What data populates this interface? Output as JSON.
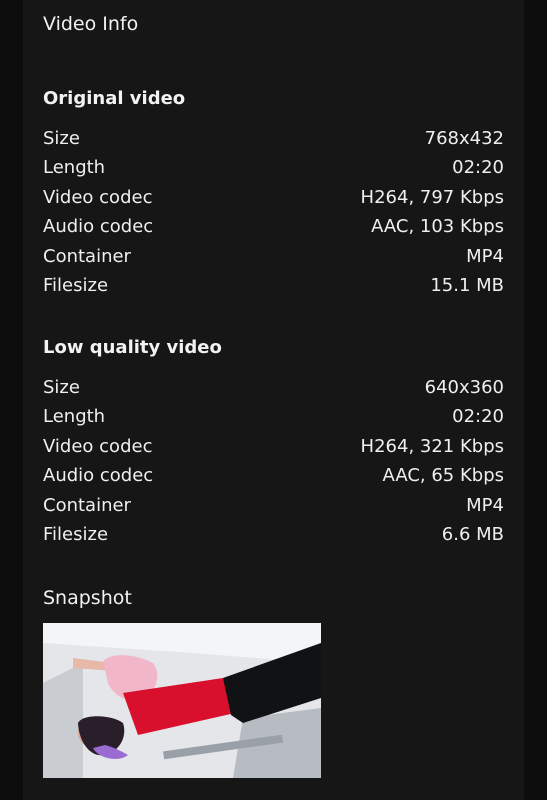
{
  "header": {
    "title": "Video Info"
  },
  "original": {
    "title": "Original video",
    "rows": [
      {
        "label": "Size",
        "value": "768x432"
      },
      {
        "label": "Length",
        "value": "02:20"
      },
      {
        "label": "Video codec",
        "value": "H264, 797 Kbps"
      },
      {
        "label": "Audio codec",
        "value": "AAC, 103 Kbps"
      },
      {
        "label": "Container",
        "value": "MP4"
      },
      {
        "label": "Filesize",
        "value": "15.1 MB"
      }
    ]
  },
  "low_quality": {
    "title": "Low quality video",
    "rows": [
      {
        "label": "Size",
        "value": "640x360"
      },
      {
        "label": "Length",
        "value": "02:20"
      },
      {
        "label": "Video codec",
        "value": "H264, 321 Kbps"
      },
      {
        "label": "Audio codec",
        "value": "AAC, 65 Kbps"
      },
      {
        "label": "Container",
        "value": "MP4"
      },
      {
        "label": "Filesize",
        "value": "6.6 MB"
      }
    ]
  },
  "snapshot": {
    "label": "Snapshot"
  }
}
